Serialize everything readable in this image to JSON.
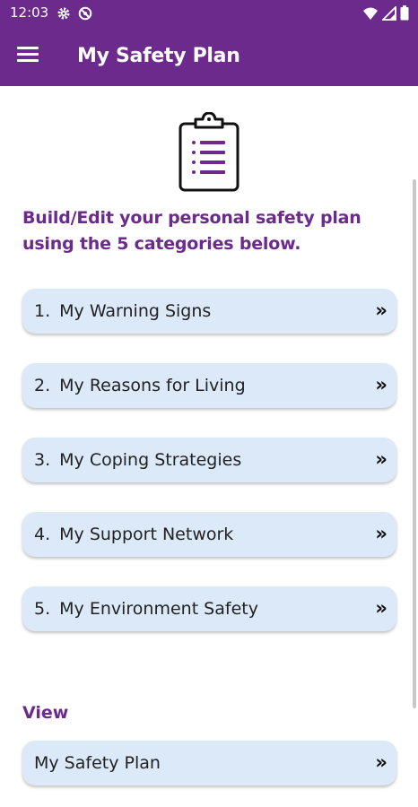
{
  "status_bar": {
    "time": "12:03",
    "left_icons": [
      "gear-icon",
      "no-sync-icon"
    ],
    "right_icons": [
      "wifi-icon",
      "signal-icon",
      "battery-icon"
    ]
  },
  "app_bar": {
    "title": "My Safety Plan",
    "color": "#6b2a8c"
  },
  "main": {
    "header_icon": "clipboard-icon",
    "intro_text": "Build/Edit your personal safety plan using the 5 categories below.",
    "categories": [
      {
        "number": "1.",
        "label": "My Warning Signs"
      },
      {
        "number": "2.",
        "label": "My Reasons for Living"
      },
      {
        "number": "3.",
        "label": "My Coping Strategies"
      },
      {
        "number": "4.",
        "label": "My Support Network"
      },
      {
        "number": "5.",
        "label": "My Environment Safety"
      }
    ],
    "chevron": "»",
    "view_section": {
      "heading": "View",
      "button_label": "My Safety Plan"
    }
  },
  "colors": {
    "accent": "#6b2a8c",
    "button_bg": "#dbe9f8"
  }
}
